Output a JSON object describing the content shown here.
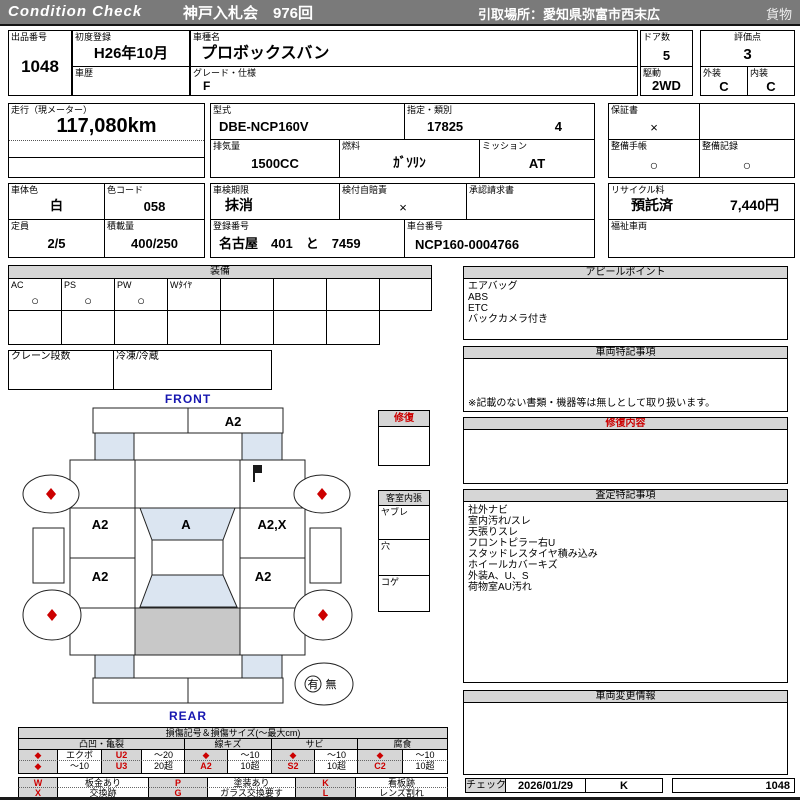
{
  "header": {
    "brand": "Condition  Check",
    "auction": "神戸入札会　976回",
    "pickup": "引取場所：愛知県弥富市西末広",
    "category": "貨物"
  },
  "info": {
    "lot": {
      "label": "出品番号",
      "value": "1048"
    },
    "first_reg": {
      "label": "初度登録",
      "value": "H26年10月"
    },
    "history": {
      "label": "車歴",
      "value": ""
    },
    "model_name": {
      "label": "車種名",
      "value": "プロボックスバン"
    },
    "grade": {
      "label": "グレード・仕様",
      "value": "F"
    },
    "doors": {
      "label": "ドア数",
      "value": "5"
    },
    "score": {
      "label": "評価点",
      "value": "3"
    },
    "drive": {
      "label": "駆動",
      "value": "2WD"
    },
    "exterior": {
      "label": "外装",
      "value": "C"
    },
    "interior": {
      "label": "内装",
      "value": "C"
    },
    "mileage": {
      "label": "走行（現メーター）",
      "value": "117,080km"
    },
    "model_code": {
      "label": "型式",
      "value": "DBE-NCP160V"
    },
    "designation": {
      "label": "指定・類別",
      "number": "17825",
      "class": "4"
    },
    "warranty": {
      "label": "保証書",
      "value": "×"
    },
    "displacement": {
      "label": "排気量",
      "value": "1500CC"
    },
    "fuel": {
      "label": "燃料",
      "value": "ｶﾞｿﾘﾝ"
    },
    "transmission": {
      "label": "ミッション",
      "value": "AT"
    },
    "maintenance_book": {
      "label": "整備手帳",
      "value": "○"
    },
    "maintenance_record": {
      "label": "整備記録",
      "value": "○"
    },
    "body_color": {
      "label": "車体色",
      "value": "白"
    },
    "color_code": {
      "label": "色コード",
      "value": "058"
    },
    "inspection_expiry": {
      "label": "車検期限",
      "value": "抹消"
    },
    "liability_insurance": {
      "label": "検付自賠責",
      "value": "×"
    },
    "approval_request": {
      "label": "承認請求書",
      "value": ""
    },
    "recycle_fee": {
      "label": "リサイクル料",
      "status": "預託済",
      "amount": "7,440円"
    },
    "capacity": {
      "label": "定員",
      "value": "2/5"
    },
    "load_capacity": {
      "label": "積載量",
      "value": "400/250"
    },
    "reg_number": {
      "label": "登録番号",
      "value": "名古屋　401　と　7459"
    },
    "chassis_number": {
      "label": "車台番号",
      "value": "NCP160-0004766"
    },
    "welfare_vehicle": {
      "label": "福祉車両",
      "value": ""
    }
  },
  "equipment": {
    "title": "装備",
    "items": [
      {
        "label": "AC",
        "value": "○"
      },
      {
        "label": "PS",
        "value": "○"
      },
      {
        "label": "PW",
        "value": "○"
      },
      {
        "label": "Wﾀｲﾔ",
        "value": ""
      },
      {
        "label": "",
        "value": ""
      },
      {
        "label": "",
        "value": ""
      },
      {
        "label": "",
        "value": ""
      },
      {
        "label": "",
        "value": ""
      }
    ],
    "crane": {
      "label": "クレーン段数",
      "value": ""
    },
    "fridge": {
      "label": "冷凍/冷蔵",
      "value": ""
    }
  },
  "diagram": {
    "front_label": "FRONT",
    "rear_label": "REAR",
    "front_bumper": "A2",
    "left_front_panel": "A2",
    "windshield": "A",
    "right_front_panel": "A2,X",
    "left_rear_panel": "A2",
    "right_rear_panel": "A2",
    "spare_yes": "有",
    "spare_no": "無",
    "repair": {
      "title": "修復"
    },
    "cabin": {
      "title": "客室内張",
      "rows": [
        "ヤブレ",
        "穴",
        "コゲ"
      ]
    }
  },
  "panels": {
    "appeal": {
      "title": "アピールポイント",
      "lines": [
        "エアバッグ",
        "ABS",
        "ETC",
        "バックカメラ付き"
      ]
    },
    "vehicle_notes": {
      "title": "車両特記事項",
      "note": "※記載のない書類・機器等は無しとして取り扱います。"
    },
    "repair_detail": {
      "title": "修復内容"
    },
    "assessment": {
      "title": "査定特記事項",
      "lines": [
        "社外ナビ",
        "室内汚れ/スレ",
        "天張りスレ",
        "フロントピラー右U",
        "スタッドレスタイヤ積み込み",
        "ホイールカバーキズ",
        "外装A、U、S",
        "荷物室AU汚れ"
      ]
    },
    "change_info": {
      "title": "車両変更情報"
    }
  },
  "check": {
    "label": "チェック",
    "date": "2026/01/29",
    "inspector": "K",
    "lot": "1048"
  },
  "legend": {
    "title": "損傷記号＆損傷サイズ(～最大cm)",
    "groups": [
      {
        "name": "凸凹・亀裂",
        "rows": [
          [
            "◆",
            "エクボ",
            "U2",
            "～20"
          ],
          [
            "◆",
            "～10",
            "U3",
            "20超"
          ]
        ]
      },
      {
        "name": "線キズ",
        "rows": [
          [
            "◆",
            "～10"
          ],
          [
            "A2",
            "10超"
          ]
        ]
      },
      {
        "name": "サビ",
        "rows": [
          [
            "◆",
            "～10"
          ],
          [
            "S2",
            "10超"
          ]
        ]
      },
      {
        "name": "腐食",
        "rows": [
          [
            "◆",
            "～10"
          ],
          [
            "C2",
            "10超"
          ]
        ]
      }
    ],
    "codes": [
      [
        {
          "code": "W",
          "desc": "板金あり"
        },
        {
          "code": "P",
          "desc": "塗装あり"
        },
        {
          "code": "K",
          "desc": "看板跡"
        }
      ],
      [
        {
          "code": "X",
          "desc": "交換跡"
        },
        {
          "code": "G",
          "desc": "ガラス交換要す"
        },
        {
          "code": "L",
          "desc": "レンズ割れ"
        }
      ]
    ]
  },
  "colors": {
    "accent_red": "#cc0000",
    "label_blue": "#1717b0",
    "glass_blue": "#dbe5f1",
    "cargo_gray": "#c8c8c8",
    "header_gray": "#7a7a7a"
  }
}
